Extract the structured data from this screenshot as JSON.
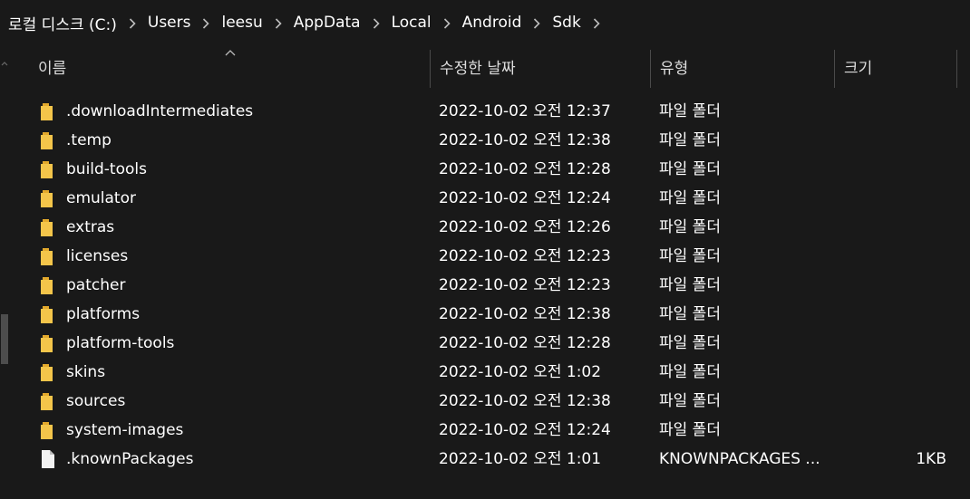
{
  "breadcrumb": {
    "items": [
      {
        "label": "로컬 디스크 (C:)"
      },
      {
        "label": "Users"
      },
      {
        "label": "leesu"
      },
      {
        "label": "AppData"
      },
      {
        "label": "Local"
      },
      {
        "label": "Android"
      },
      {
        "label": "Sdk"
      }
    ]
  },
  "columns": {
    "name": "이름",
    "date": "수정한 날짜",
    "type": "유형",
    "size": "크기"
  },
  "files": [
    {
      "name": ".downloadIntermediates",
      "date": "2022-10-02 오전 12:37",
      "type": "파일 폴더",
      "size": "",
      "icon": "folder-icon"
    },
    {
      "name": ".temp",
      "date": "2022-10-02 오전 12:38",
      "type": "파일 폴더",
      "size": "",
      "icon": "folder-icon"
    },
    {
      "name": "build-tools",
      "date": "2022-10-02 오전 12:28",
      "type": "파일 폴더",
      "size": "",
      "icon": "folder-icon"
    },
    {
      "name": "emulator",
      "date": "2022-10-02 오전 12:24",
      "type": "파일 폴더",
      "size": "",
      "icon": "folder-icon"
    },
    {
      "name": "extras",
      "date": "2022-10-02 오전 12:26",
      "type": "파일 폴더",
      "size": "",
      "icon": "folder-icon"
    },
    {
      "name": "licenses",
      "date": "2022-10-02 오전 12:23",
      "type": "파일 폴더",
      "size": "",
      "icon": "folder-icon"
    },
    {
      "name": "patcher",
      "date": "2022-10-02 오전 12:23",
      "type": "파일 폴더",
      "size": "",
      "icon": "folder-icon"
    },
    {
      "name": "platforms",
      "date": "2022-10-02 오전 12:38",
      "type": "파일 폴더",
      "size": "",
      "icon": "folder-icon"
    },
    {
      "name": "platform-tools",
      "date": "2022-10-02 오전 12:28",
      "type": "파일 폴더",
      "size": "",
      "icon": "folder-icon"
    },
    {
      "name": "skins",
      "date": "2022-10-02 오전 1:02",
      "type": "파일 폴더",
      "size": "",
      "icon": "folder-icon"
    },
    {
      "name": "sources",
      "date": "2022-10-02 오전 12:38",
      "type": "파일 폴더",
      "size": "",
      "icon": "folder-icon"
    },
    {
      "name": "system-images",
      "date": "2022-10-02 오전 12:24",
      "type": "파일 폴더",
      "size": "",
      "icon": "folder-icon"
    },
    {
      "name": ".knownPackages",
      "date": "2022-10-02 오전 1:01",
      "type": "KNOWNPACKAGES ...",
      "size": "1KB",
      "icon": "file-icon"
    }
  ],
  "colors": {
    "background": "#191919",
    "folder": "#f4c54a",
    "file": "#f2f2f2",
    "text": "#ffffff",
    "divider": "#4a4a4a"
  }
}
